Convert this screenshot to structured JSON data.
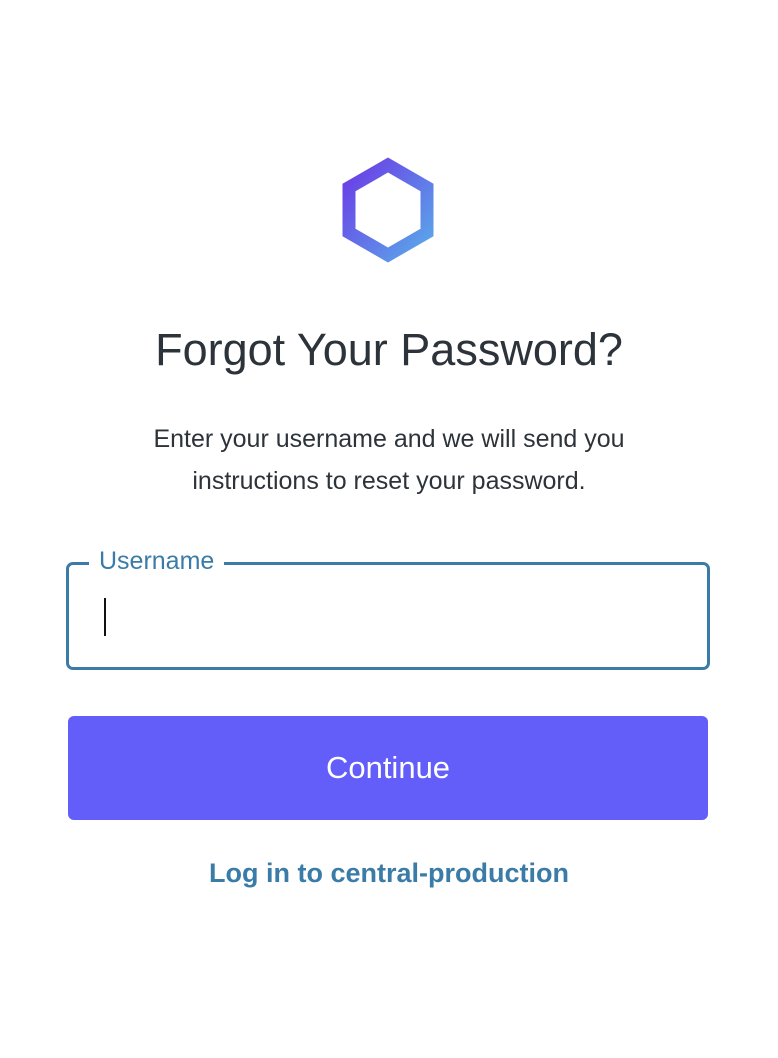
{
  "logo": {
    "icon": "hexagon-logo-icon",
    "gradient_start": "#6b3ce6",
    "gradient_end": "#5aa8ea"
  },
  "heading": "Forgot Your Password?",
  "description_line1": "Enter your username and we will send you",
  "description_line2": "instructions to reset your password.",
  "form": {
    "username_label": "Username",
    "username_value": "",
    "continue_label": "Continue"
  },
  "footer": {
    "login_link": "Log in to central-production"
  },
  "colors": {
    "accent": "#635dfa",
    "link": "#3a7ba8",
    "text": "#2d333a"
  }
}
